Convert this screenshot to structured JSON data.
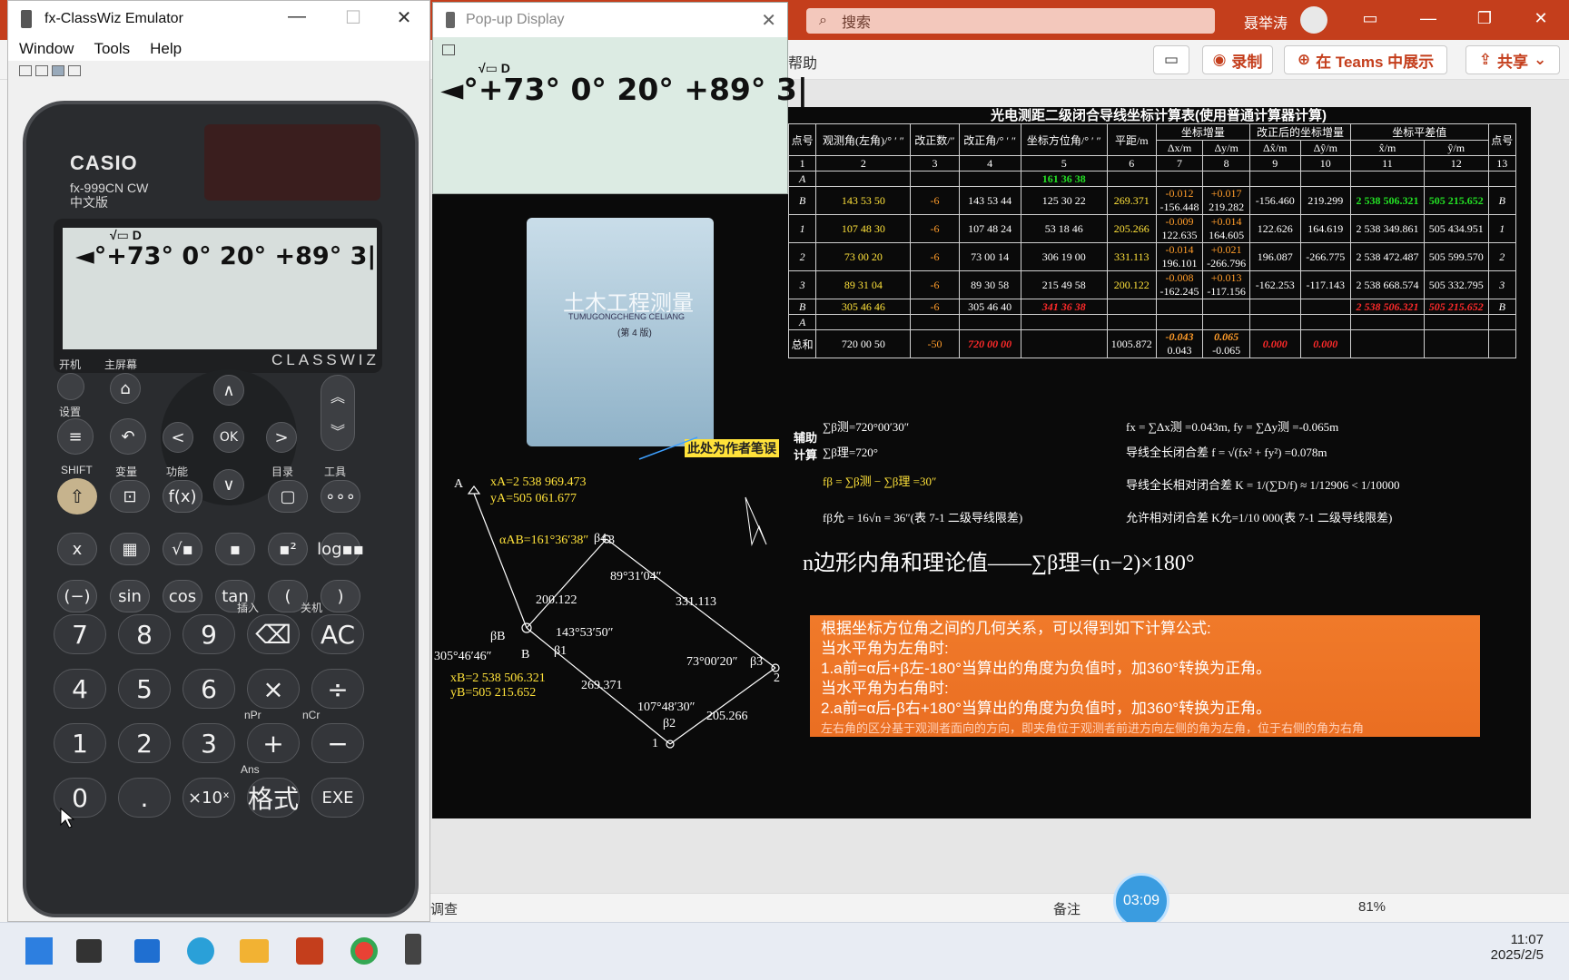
{
  "emulator": {
    "title": "fx-ClassWiz Emulator",
    "menu": [
      "Window",
      "Tools",
      "Help"
    ],
    "calculator": {
      "brand": "CASIO",
      "model": "fx-999CN CW",
      "model_sub": "中文版",
      "series": "CLASSWIZ",
      "indicator": "√▭ D",
      "display": "◄°+73° 0° 20° +89° 3|",
      "top_labels": {
        "power": "开机",
        "home": "主屏幕",
        "settings": "设置",
        "shift": "SHIFT",
        "var": "变量",
        "func": "功能",
        "catalog": "目录",
        "tools": "工具"
      },
      "keys_func": [
        "x",
        "▦",
        "√▪",
        "▪",
        "▪²",
        "log▪▪",
        "(−)",
        "sin",
        "cos",
        "tan",
        "(",
        ")"
      ],
      "keys_num": [
        "7",
        "8",
        "9",
        "⌫",
        "AC",
        "4",
        "5",
        "6",
        "×",
        "÷",
        "1",
        "2",
        "3",
        "+",
        "−",
        "0",
        ".",
        "×10ˣ",
        "格式",
        "EXE"
      ],
      "key_labels": {
        "insert": "插入",
        "off": "关机",
        "npr": "nPr",
        "ncr": "nCr",
        "ans": "Ans"
      }
    }
  },
  "popup": {
    "title": "Pop-up Display",
    "indicator": "√▭ D",
    "display": "◄°+73° 0° 20° +89° 3|"
  },
  "powerpoint": {
    "search_placeholder": "搜索",
    "user": "聂举涛",
    "ribbon_fragment": "帮助",
    "buttons": {
      "record": "录制",
      "teams": "在 Teams 中展示",
      "share": "共享"
    },
    "status": {
      "left": "调查",
      "notes": "备注",
      "timer": "03:09",
      "zoom": "81%"
    },
    "slide": {
      "table_title": "光电测距二级闭合导线坐标计算表(使用普通计算器计算)",
      "headers": [
        "点号",
        "观测角(左角)/° ′ ″",
        "改正数/″",
        "改正角/° ′ ″",
        "坐标方位角/° ′ ″",
        "平距/m",
        "坐标增量",
        "改正后的坐标增量",
        "坐标平差值",
        "点号"
      ],
      "subheaders": [
        "Δx/m",
        "Δy/m",
        "Δx̂/m",
        "Δŷ/m",
        "x̂/m",
        "ŷ/m"
      ],
      "col_numbers": [
        "1",
        "2",
        "3",
        "4",
        "5",
        "6",
        "7",
        "8",
        "9",
        "10",
        "11",
        "12",
        "13"
      ],
      "rows": [
        {
          "pt": "A",
          "az": "161 36 38"
        },
        {
          "pt": "B",
          "obs": "143 53 50",
          "corr": "-6",
          "adj": "143 53 44",
          "az": "125 30 22",
          "dist": "269.371",
          "cx": "-0.012",
          "dx": "-156.448",
          "cy": "+0.017",
          "dy": "219.282",
          "adx": "-156.460",
          "ady": "219.299",
          "x": "2 538 506.321",
          "y": "505 215.652",
          "pt2": "B"
        },
        {
          "pt": "1",
          "obs": "107 48 30",
          "corr": "-6",
          "adj": "107 48 24",
          "az": "53 18 46",
          "dist": "205.266",
          "cx": "-0.009",
          "dx": "122.635",
          "cy": "+0.014",
          "dy": "164.605",
          "adx": "122.626",
          "ady": "164.619",
          "x": "2 538 349.861",
          "y": "505 434.951",
          "pt2": "1"
        },
        {
          "pt": "2",
          "obs": "73 00 20",
          "corr": "-6",
          "adj": "73 00 14",
          "az": "306 19 00",
          "dist": "331.113",
          "cx": "-0.014",
          "dx": "196.101",
          "cy": "+0.021",
          "dy": "-266.796",
          "adx": "196.087",
          "ady": "-266.775",
          "x": "2 538 472.487",
          "y": "505 599.570",
          "pt2": "2"
        },
        {
          "pt": "3",
          "obs": "89 31 04",
          "corr": "-6",
          "adj": "89 30 58",
          "az": "215 49 58",
          "dist": "200.122",
          "cx": "-0.008",
          "dx": "-162.245",
          "cy": "+0.013",
          "dy": "-117.156",
          "adx": "-162.253",
          "ady": "-117.143",
          "x": "2 538 668.574",
          "y": "505 332.795",
          "pt2": "3"
        },
        {
          "pt": "B",
          "obs": "305 46 46",
          "corr": "-6",
          "adj": "305 46 40",
          "az": "341 36 38",
          "x": "2 538 506.321",
          "y": "505 215.652",
          "pt2": "B"
        },
        {
          "pt": "A"
        }
      ],
      "sum_row": {
        "label": "总和",
        "obs": "720 00 50",
        "corr": "-50",
        "adj": "720 00 00",
        "dist": "1005.872",
        "fx": "-0.043",
        "fy": "0.065",
        "dx": "0.043",
        "dy": "-0.065",
        "adx": "0.000",
        "ady": "0.000"
      },
      "aux_label": "辅助计算",
      "aux_lines": [
        "∑β测=720°00′30″",
        "∑β理=720°",
        "fβ = ∑β测 − ∑β理 =30″",
        "fβ允 = 16√n = 36″(表 7-1 二级导线限差)",
        "fx = ∑Δx测 =0.043m,  fy = ∑Δy测 =-0.065m",
        "导线全长闭合差 f = √(fx² + fy²) =0.078m",
        "导线全长相对闭合差 K = 1/(∑D/f) ≈ 1/12906 < 1/10000",
        "允许相对闭合差 K允=1/10 000(表 7-1 二级导线限差)"
      ],
      "formula": "n边形内角和理论值——∑β理=(n−2)×180°",
      "explain": [
        "根据坐标方位角之间的几何关系，可以得到如下计算公式:",
        "当水平角为左角时:",
        "1.a前=α后+β左-180°当算出的角度为负值时，加360°转换为正角。",
        "当水平角为右角时:",
        "2.a前=α后-β右+180°当算出的角度为负值时，加360°转换为正角。",
        "左右角的区分基于观测者面向的方向，即夹角位于观测者前进方向左侧的角为左角，位于右侧的角为右角"
      ],
      "book_title": "土木工程测量",
      "book_sub": "TUMUGONGCHENG CELIANG",
      "book_edition": "(第 4 版)",
      "note_tag": "此处为作者笔误",
      "sketch": {
        "a_coords": [
          "xA=2 538 969.473",
          "yA=505 061.677"
        ],
        "b_coords": [
          "xB=2 538 506.321",
          "yB=505 215.652"
        ],
        "alpha": "αAB=161°36′38″",
        "angles": [
          "89°31′04″",
          "143°53′50″",
          "305°46′46″",
          "73°00′20″",
          "107°48′30″"
        ],
        "dists": [
          "200.122",
          "331.113",
          "269.371",
          "205.266"
        ],
        "points": [
          "A",
          "B",
          "1",
          "2",
          "3"
        ],
        "betas": [
          "β4",
          "βB",
          "β1",
          "β3",
          "β2"
        ]
      }
    }
  },
  "taskbar": {
    "time": "11:07",
    "date": "2025/2/5"
  },
  "colors": {
    "ppt_red": "#c43e1c",
    "slide_bg": "#0a0a0a",
    "highlight_yellow": "#ffe23a",
    "highlight_green": "#23e024",
    "orange": "#ea6e22"
  }
}
